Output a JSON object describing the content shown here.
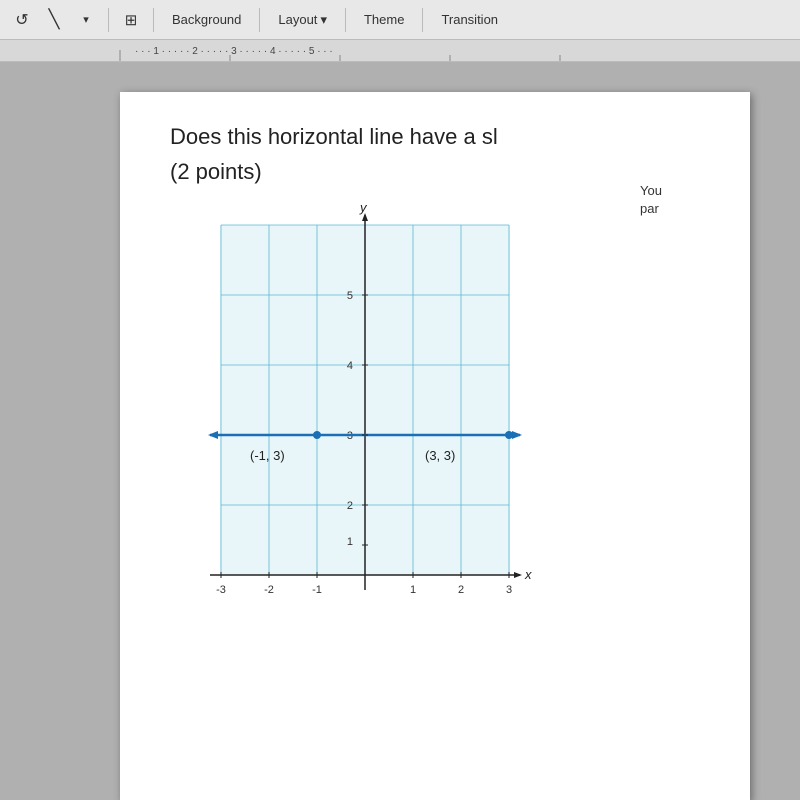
{
  "toolbar": {
    "icons": [
      {
        "name": "undo-icon",
        "symbol": "↺"
      },
      {
        "name": "cursor-icon",
        "symbol": "\\"
      },
      {
        "name": "dropdown-arrow",
        "symbol": "▾"
      },
      {
        "name": "layout-icon",
        "symbol": "⊞"
      }
    ],
    "buttons": [
      {
        "id": "background-btn",
        "label": "Background",
        "hasArrow": false
      },
      {
        "id": "layout-btn",
        "label": "Layout",
        "hasArrow": true
      },
      {
        "id": "theme-btn",
        "label": "Theme",
        "hasArrow": false
      },
      {
        "id": "transition-btn",
        "label": "Transition",
        "hasArrow": false
      }
    ]
  },
  "ruler": {
    "marks": [
      "1",
      "2",
      "3",
      "4",
      "5"
    ]
  },
  "slide": {
    "question": "Does this horizontal line have a sl",
    "points": "(2 points)",
    "side_note_line1": "You",
    "side_note_line2": "par",
    "graph": {
      "points": [
        {
          "label": "(-1, 3)",
          "x": -1,
          "y": 3
        },
        {
          "label": "(3, 3)",
          "x": 3,
          "y": 3
        }
      ],
      "x_label": "x",
      "y_label": "y",
      "x_min": -3,
      "x_max": 3,
      "y_min": 0,
      "y_max": 5,
      "grid_color": "#5bb8d4",
      "axis_color": "#222"
    }
  }
}
